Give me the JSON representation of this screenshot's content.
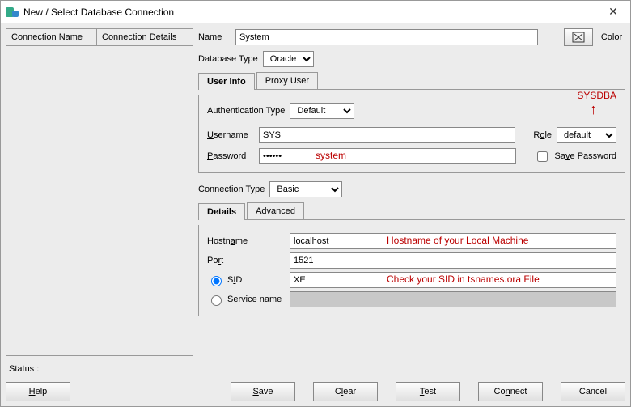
{
  "window": {
    "title": "New / Select Database Connection"
  },
  "left": {
    "col1": "Connection Name",
    "col2": "Connection Details"
  },
  "name": {
    "label": "Name",
    "value": "System"
  },
  "color": {
    "label": "Color"
  },
  "dbtype": {
    "label": "Database Type",
    "value": "Oracle"
  },
  "tabs": {
    "userinfo": "User Info",
    "proxy": "Proxy User"
  },
  "auth": {
    "label": "Authentication Type",
    "value": "Default"
  },
  "username": {
    "label": "Username",
    "value": "SYS"
  },
  "password": {
    "label": "Password",
    "value": "••••••"
  },
  "role": {
    "label": "Role",
    "value": "default"
  },
  "savepwd": {
    "label": "Save Password"
  },
  "conntype": {
    "label": "Connection Type",
    "value": "Basic"
  },
  "tabs2": {
    "details": "Details",
    "advanced": "Advanced"
  },
  "hostname": {
    "label": "Hostname",
    "value": "localhost"
  },
  "port": {
    "label": "Port",
    "value": "1521"
  },
  "sid": {
    "label": "SID",
    "value": "XE"
  },
  "service": {
    "label": "Service name"
  },
  "status": {
    "label": "Status :"
  },
  "buttons": {
    "help": "Help",
    "save": "Save",
    "clear": "Clear",
    "test": "Test",
    "connect": "Connect",
    "cancel": "Cancel"
  },
  "annotations": {
    "sysdba": "SYSDBA",
    "system": "system",
    "hostname": "Hostname of your Local Machine",
    "sid": "Check your SID in tsnames.ora File"
  }
}
